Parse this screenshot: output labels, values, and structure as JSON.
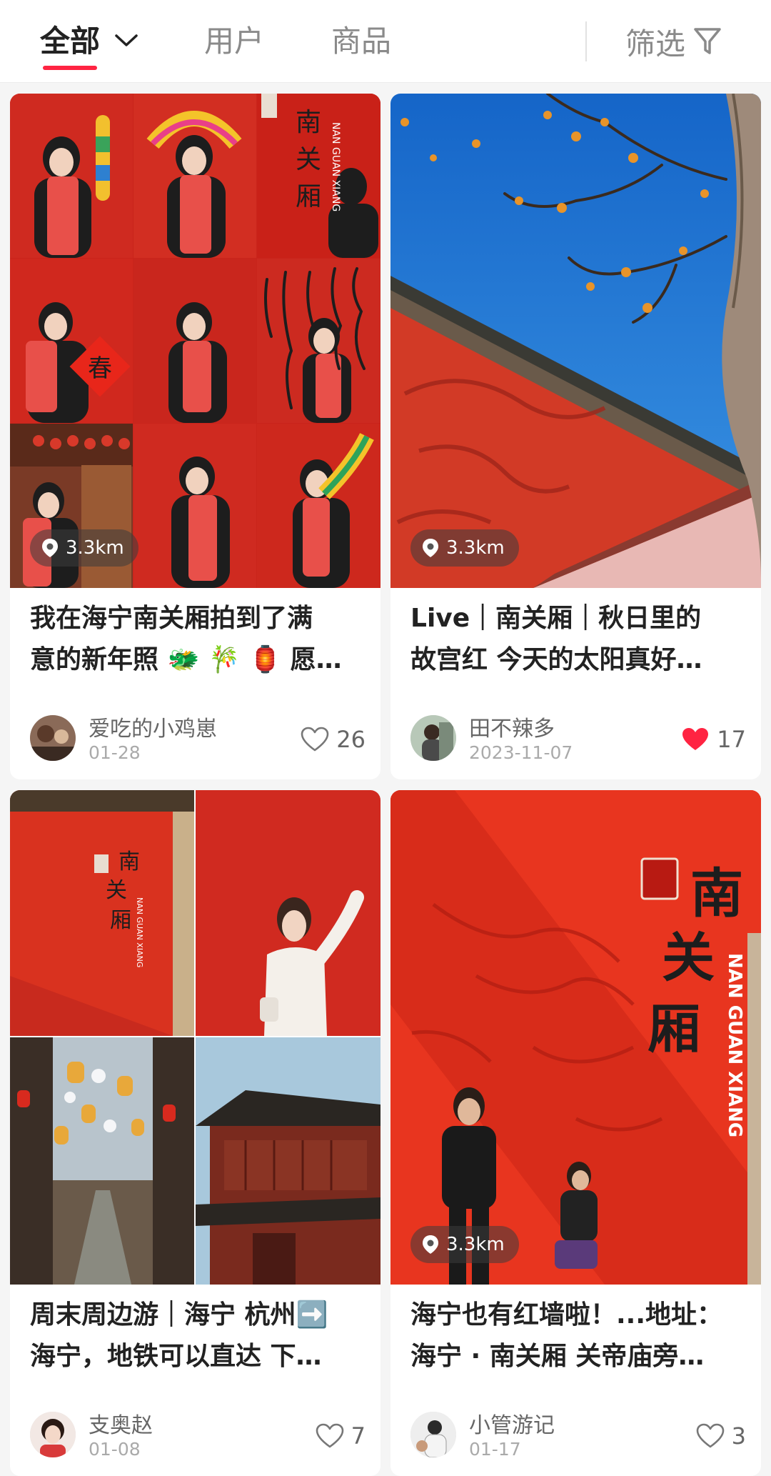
{
  "tabs": {
    "all": "全部",
    "users": "用户",
    "goods": "商品",
    "filter": "筛选"
  },
  "cards": [
    {
      "distance": "3.3km",
      "title": "我在海宁南关厢拍到了满\n意的新年照 🐲 🎋 🏮 愿…",
      "author": "爱吃的小鸡崽",
      "date": "01-28",
      "likes": "26",
      "liked": false,
      "image": {
        "sign_chars": "南关厢",
        "sign_en": "NAN GUAN XIANG",
        "couplet_char": "春"
      }
    },
    {
      "distance": "3.3km",
      "title": "Live｜南关厢｜秋日里的\n故宫红 今天的太阳真好…",
      "author": "田不辣多",
      "date": "2023-11-07",
      "likes": "17",
      "liked": true
    },
    {
      "title": "周末周边游｜海宁 杭州➡️\n海宁，地铁可以直达 下…",
      "author": "支奥赵",
      "date": "01-08",
      "likes": "7",
      "liked": false,
      "image": {
        "sign_chars": "南关厢",
        "sign_en": "NAN GUAN XIANG"
      }
    },
    {
      "distance": "3.3km",
      "title": "海宁也有红墙啦！...地址：\n海宁 · 南关厢 关帝庙旁…",
      "author": "小管游记",
      "date": "01-17",
      "likes": "3",
      "liked": false,
      "image": {
        "sign_chars": "南关厢",
        "sign_en": "NAN GUAN XIANG"
      }
    }
  ],
  "colors": {
    "accent": "#ff2442",
    "wall_red": "#d8261c",
    "sky_blue": "#1a7fd8"
  },
  "icons": [
    "chevron-down-icon",
    "filter-funnel-icon",
    "location-pin-icon",
    "heart-outline-icon",
    "heart-filled-icon"
  ]
}
